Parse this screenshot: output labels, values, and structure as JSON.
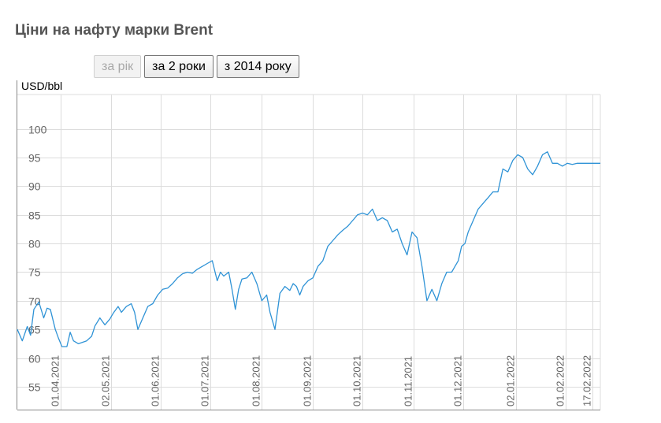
{
  "header": {
    "title": "Ціни на нафту марки Brent"
  },
  "range_buttons": [
    {
      "label": "за рік",
      "disabled": true
    },
    {
      "label": "за 2 роки",
      "disabled": false
    },
    {
      "label": "з 2014 року",
      "disabled": false
    }
  ],
  "chart_data": {
    "type": "line",
    "title": "Ціни на нафту марки Brent",
    "ylabel": "USD/bbl",
    "xlabel": "",
    "ylim": [
      51,
      106
    ],
    "xlim": [
      "2021-03-06",
      "2022-02-22"
    ],
    "y_ticks": [
      55,
      60,
      65,
      70,
      75,
      80,
      85,
      90,
      95,
      100
    ],
    "x_ticks": [
      "01.04.2021",
      "02.05.2021",
      "01.06.2021",
      "01.07.2021",
      "01.08.2021",
      "01.09.2021",
      "01.10.2021",
      "01.11.2021",
      "01.12.2021",
      "02.01.2022",
      "01.02.2022",
      "17.02.2022"
    ],
    "grid": true,
    "legend": "none",
    "colors": {
      "line": "#2f93d6",
      "grid": "#dcdcdc",
      "axis": "#888888",
      "tick_text": "#666666"
    },
    "series": [
      {
        "x": [
          "2021-03-06",
          "2021-03-09",
          "2021-03-12",
          "2021-03-14",
          "2021-03-16",
          "2021-03-19",
          "2021-03-22",
          "2021-03-24",
          "2021-03-26",
          "2021-03-29",
          "2021-03-31",
          "2021-04-02",
          "2021-04-05",
          "2021-04-07",
          "2021-04-09",
          "2021-04-12",
          "2021-04-14",
          "2021-04-17",
          "2021-04-20",
          "2021-04-22",
          "2021-04-25",
          "2021-04-28",
          "2021-05-01",
          "2021-05-03",
          "2021-05-06",
          "2021-05-08",
          "2021-05-11",
          "2021-05-14",
          "2021-05-16",
          "2021-05-18",
          "2021-05-21",
          "2021-05-24",
          "2021-05-27",
          "2021-05-30",
          "2021-06-02",
          "2021-06-05",
          "2021-06-08",
          "2021-06-11",
          "2021-06-14",
          "2021-06-17",
          "2021-06-20",
          "2021-06-23",
          "2021-06-26",
          "2021-06-29",
          "2021-07-02",
          "2021-07-05",
          "2021-07-07",
          "2021-07-09",
          "2021-07-12",
          "2021-07-14",
          "2021-07-16",
          "2021-07-18",
          "2021-07-20",
          "2021-07-23",
          "2021-07-26",
          "2021-07-29",
          "2021-08-01",
          "2021-08-04",
          "2021-08-06",
          "2021-08-09",
          "2021-08-12",
          "2021-08-15",
          "2021-08-18",
          "2021-08-20",
          "2021-08-22",
          "2021-08-24",
          "2021-08-26",
          "2021-08-29",
          "2021-09-01",
          "2021-09-04",
          "2021-09-07",
          "2021-09-10",
          "2021-09-13",
          "2021-09-16",
          "2021-09-19",
          "2021-09-22",
          "2021-09-25",
          "2021-09-28",
          "2021-10-01",
          "2021-10-04",
          "2021-10-07",
          "2021-10-10",
          "2021-10-13",
          "2021-10-16",
          "2021-10-19",
          "2021-10-22",
          "2021-10-25",
          "2021-10-28",
          "2021-10-31",
          "2021-11-03",
          "2021-11-06",
          "2021-11-09",
          "2021-11-12",
          "2021-11-15",
          "2021-11-18",
          "2021-11-21",
          "2021-11-24",
          "2021-11-26",
          "2021-11-28",
          "2021-11-30",
          "2021-12-02",
          "2021-12-04",
          "2021-12-07",
          "2021-12-10",
          "2021-12-13",
          "2021-12-16",
          "2021-12-19",
          "2021-12-22",
          "2021-12-25",
          "2021-12-28",
          "2021-12-31",
          "2022-01-03",
          "2022-01-06",
          "2022-01-09",
          "2022-01-12",
          "2022-01-15",
          "2022-01-18",
          "2022-01-21",
          "2022-01-24",
          "2022-01-27",
          "2022-01-30",
          "2022-02-02",
          "2022-02-05",
          "2022-02-08",
          "2022-02-11",
          "2022-02-14",
          "2022-02-15",
          "2022-02-16",
          "2022-02-17",
          "2022-02-18",
          "2022-02-20",
          "2022-02-22"
        ],
        "y": [
          65.0,
          63.0,
          65.5,
          64.0,
          68.5,
          69.8,
          67.0,
          68.7,
          68.5,
          65.0,
          63.4,
          62.0,
          62.0,
          64.5,
          63.0,
          62.5,
          62.7,
          63.0,
          63.8,
          65.6,
          67.0,
          65.8,
          66.8,
          67.8,
          69.0,
          68.0,
          69.0,
          69.5,
          68.0,
          65.0,
          67.0,
          69.0,
          69.5,
          71.0,
          72.0,
          72.2,
          73.0,
          74.0,
          74.7,
          75.0,
          74.8,
          75.5,
          76.0,
          76.5,
          77.0,
          73.5,
          75.0,
          74.3,
          75.0,
          72.0,
          68.5,
          72.0,
          73.8,
          74.0,
          75.0,
          73.0,
          70.0,
          71.0,
          68.0,
          65.0,
          71.3,
          72.5,
          71.8,
          73.0,
          72.5,
          71.0,
          72.5,
          73.5,
          74.0,
          76.0,
          77.0,
          79.5,
          80.5,
          81.5,
          82.3,
          83.0,
          84.0,
          85.0,
          85.3,
          85.0,
          86.0,
          84.0,
          84.5,
          84.0,
          82.0,
          82.5,
          80.0,
          78.0,
          82.0,
          81.0,
          76.0,
          70.0,
          72.0,
          70.0,
          73.0,
          75.0,
          75.0,
          76.0,
          77.0,
          79.5,
          80.0,
          82.0,
          84.0,
          86.0,
          87.0,
          88.0,
          89.0,
          89.0,
          93.0,
          92.5,
          94.5,
          95.5,
          95.0,
          93.0,
          92.0,
          93.5,
          95.5,
          96.0,
          94.0,
          94.0,
          93.5,
          94.0,
          93.8,
          94.0,
          94.0,
          94.0,
          94.0,
          94.0,
          94.0,
          94.0,
          94.0,
          94.0
        ]
      }
    ]
  }
}
